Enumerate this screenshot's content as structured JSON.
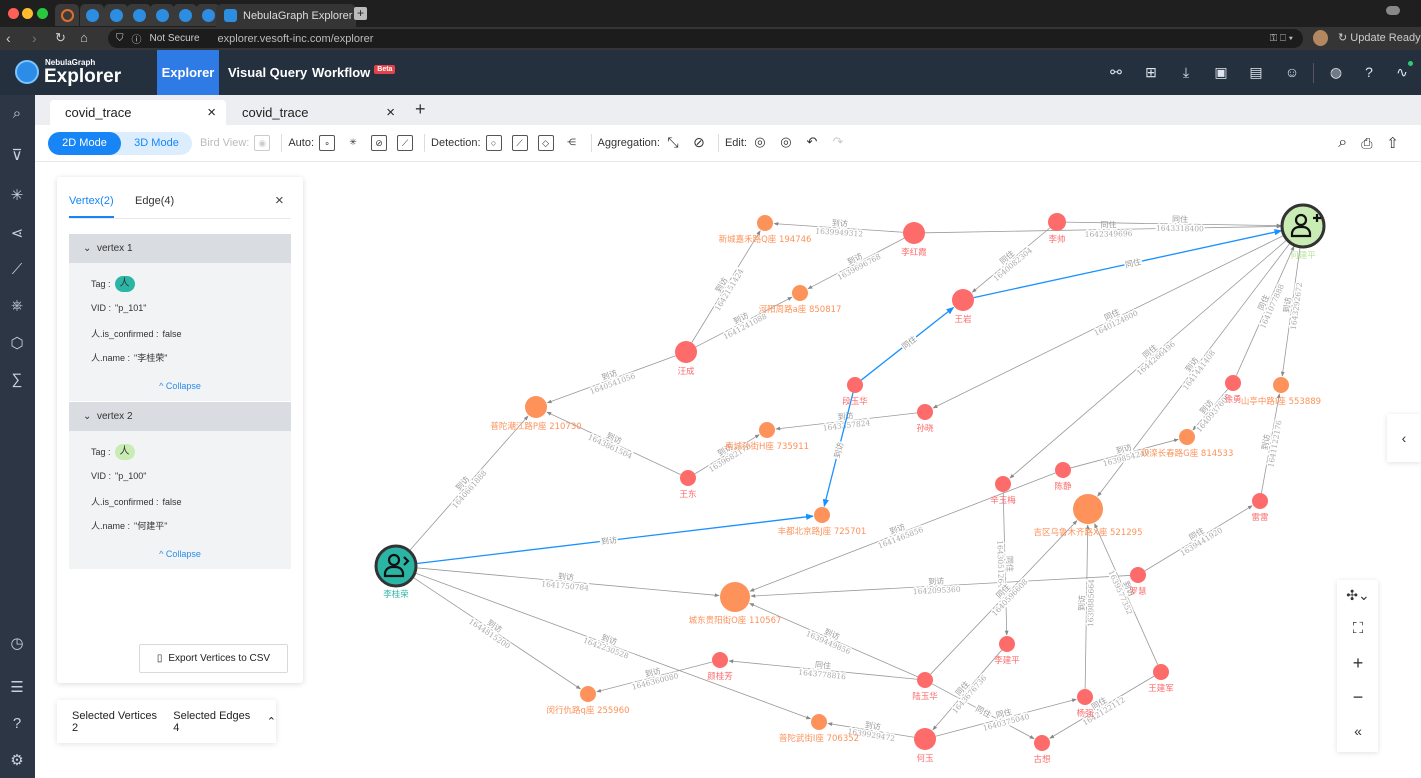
{
  "browser": {
    "tab_title": "NebulaGraph Explorer",
    "security": "Not Secure",
    "url": "explorer.vesoft-inc.com/explorer",
    "update": "Update Ready"
  },
  "app": {
    "logo_top": "NebulaGraph",
    "logo_bottom": "Explorer",
    "nav": [
      {
        "label": "Explorer"
      },
      {
        "label": "Visual Query"
      },
      {
        "label": "Workflow",
        "badge": "Beta"
      }
    ],
    "accent": "#2f7be5"
  },
  "workspace_tabs": [
    {
      "label": "covid_trace"
    },
    {
      "label": "covid_trace"
    }
  ],
  "toolbar": {
    "mode_2d": "2D Mode",
    "mode_3d": "3D Mode",
    "bird_view": "Bird View:",
    "auto": "Auto:",
    "detection": "Detection:",
    "aggregation": "Aggregation:",
    "edit": "Edit:"
  },
  "panel": {
    "tab_vertex": "Vertex(2)",
    "tab_edge": "Edge(4)",
    "collapse": "Collapse",
    "export": "Export Vertices to CSV",
    "vertices": [
      {
        "title": "vertex 1",
        "tag_label": "Tag :",
        "tag": "人",
        "tag_color": "#2bb5a5",
        "vid_label": "VID :",
        "vid": "\"p_101\"",
        "conf_label": "人.is_confirmed :",
        "conf": "false",
        "name_label": "人.name :",
        "name": "\"李桂荣\""
      },
      {
        "title": "vertex 2",
        "tag_label": "Tag :",
        "tag": "人",
        "tag_color": "#c8ecb4",
        "vid_label": "VID :",
        "vid": "\"p_100\"",
        "conf_label": "人.is_confirmed :",
        "conf": "false",
        "name_label": "人.name :",
        "name": "\"何建平\""
      }
    ]
  },
  "selection": {
    "vertices": "Selected Vertices 2",
    "edges": "Selected Edges 4"
  },
  "colors": {
    "person": "#fd6b6b",
    "place": "#fd925a",
    "selected_edge": "#1890ff",
    "edge": "#999999"
  },
  "graph": {
    "nodes": [
      {
        "id": "lgr",
        "label": "李桂荣",
        "kind": "sel1"
      },
      {
        "id": "hjp",
        "label": "何建平",
        "kind": "sel2"
      },
      {
        "id": "xcjd",
        "label": "新城嘉禾路Q座 194746",
        "kind": "place"
      },
      {
        "id": "lhx",
        "label": "李红霞",
        "kind": "person"
      },
      {
        "id": "ls",
        "label": "李帅",
        "kind": "person"
      },
      {
        "id": "hyz",
        "label": "河阳周路a座 850817",
        "kind": "place"
      },
      {
        "id": "wy",
        "label": "王岩",
        "kind": "person"
      },
      {
        "id": "wc",
        "label": "汪成",
        "kind": "person"
      },
      {
        "id": "dyh",
        "label": "段玉华",
        "kind": "person"
      },
      {
        "id": "sx",
        "label": "孙晓",
        "kind": "person"
      },
      {
        "id": "xy",
        "label": "徐勇",
        "kind": "person"
      },
      {
        "id": "stz",
        "label": "山亭中路I座 553889",
        "kind": "place"
      },
      {
        "id": "ptc",
        "label": "普陀潮江路P座 210730",
        "kind": "place"
      },
      {
        "id": "ncs",
        "label": "南城孙街H座 735911",
        "kind": "place"
      },
      {
        "id": "ssc",
        "label": "双滦长春路G座 814533",
        "kind": "place"
      },
      {
        "id": "wd",
        "label": "王东",
        "kind": "person"
      },
      {
        "id": "cj",
        "label": "陈静",
        "kind": "person"
      },
      {
        "id": "xym",
        "label": "辛玉梅",
        "kind": "person"
      },
      {
        "id": "jq",
        "label": "吉区乌鲁木齐路X座 521295",
        "kind": "place"
      },
      {
        "id": "lei",
        "label": "雷雷",
        "kind": "person"
      },
      {
        "id": "fd",
        "label": "丰都北京路J座 725701",
        "kind": "place"
      },
      {
        "id": "ldy",
        "label": "城东贵阳街O座 110567",
        "kind": "place"
      },
      {
        "id": "lh",
        "label": "罗慧",
        "kind": "person"
      },
      {
        "id": "ljp",
        "label": "李建平",
        "kind": "person"
      },
      {
        "id": "wjj",
        "label": "王建军",
        "kind": "person"
      },
      {
        "id": "ygf",
        "label": "颜桂芳",
        "kind": "person"
      },
      {
        "id": "lyh",
        "label": "陆玉华",
        "kind": "person"
      },
      {
        "id": "mhq",
        "label": "闵行仇路q座 255960",
        "kind": "place"
      },
      {
        "id": "yq",
        "label": "杨强",
        "kind": "person"
      },
      {
        "id": "pty",
        "label": "普陀武街I座 706352",
        "kind": "place"
      },
      {
        "id": "hy",
        "label": "何玉",
        "kind": "person"
      },
      {
        "id": "gx",
        "label": "古想",
        "kind": "person"
      }
    ],
    "edges": [
      {
        "s": "lhx",
        "t": "xcjd",
        "type": "到访",
        "ts": "1639949312"
      },
      {
        "s": "lhx",
        "t": "hyz",
        "type": "到访",
        "ts": "1639696768"
      },
      {
        "s": "lhx",
        "t": "hjp",
        "type": "同住",
        "ts": "1642349696"
      },
      {
        "s": "ls",
        "t": "hjp",
        "type": "同住",
        "ts": "1643318400"
      },
      {
        "s": "ls",
        "t": "wy",
        "type": "同住",
        "ts": "1640082304"
      },
      {
        "s": "wy",
        "t": "hjp",
        "type": "同住",
        "ts": "",
        "selected": true
      },
      {
        "s": "dyh",
        "t": "wy",
        "type": "同住",
        "ts": "",
        "selected": true
      },
      {
        "s": "wc",
        "t": "xcjd",
        "type": "到访",
        "ts": "1642151424"
      },
      {
        "s": "wc",
        "t": "hyz",
        "type": "到访",
        "ts": "1641241088"
      },
      {
        "s": "wc",
        "t": "ptc",
        "type": "到访",
        "ts": "1640541056"
      },
      {
        "s": "wd",
        "t": "ptc",
        "type": "到访",
        "ts": "1643861504"
      },
      {
        "s": "wd",
        "t": "ncs",
        "type": "到访",
        "ts": "1639682176"
      },
      {
        "s": "sx",
        "t": "ncs",
        "type": "到访",
        "ts": "1643357824"
      },
      {
        "s": "hjp",
        "t": "sx",
        "type": "同住",
        "ts": "1640124800"
      },
      {
        "s": "hjp",
        "t": "xym",
        "type": "同住",
        "ts": "1644266496"
      },
      {
        "s": "hjp",
        "t": "jq",
        "type": "到访",
        "ts": "1641441408"
      },
      {
        "s": "xy",
        "t": "hjp",
        "type": "同住",
        "ts": "1641077888"
      },
      {
        "s": "hjp",
        "t": "stz",
        "type": "到访",
        "ts": "1643292672"
      },
      {
        "s": "xy",
        "t": "ssc",
        "type": "到访",
        "ts": "1640937600"
      },
      {
        "s": "cj",
        "t": "ssc",
        "type": "到访",
        "ts": "1639854240"
      },
      {
        "s": "lei",
        "t": "stz",
        "type": "到访",
        "ts": "1641122176"
      },
      {
        "s": "lgr",
        "t": "ptc",
        "type": "到访",
        "ts": "1640661888"
      },
      {
        "s": "lgr",
        "t": "fd",
        "type": "到访",
        "ts": "",
        "selected": true
      },
      {
        "s": "dyh",
        "t": "fd",
        "type": "到访",
        "ts": "",
        "selected": true
      },
      {
        "s": "lgr",
        "t": "ldy",
        "type": "到访",
        "ts": "1641750784"
      },
      {
        "s": "lgr",
        "t": "mhq",
        "type": "到访",
        "ts": "1644815200"
      },
      {
        "s": "lgr",
        "t": "pty",
        "type": "到访",
        "ts": "1642230528"
      },
      {
        "s": "cj",
        "t": "ldy",
        "type": "到访",
        "ts": "1641465856"
      },
      {
        "s": "lh",
        "t": "ldy",
        "type": "到访",
        "ts": "1642095360"
      },
      {
        "s": "lh",
        "t": "lei",
        "type": "同住",
        "ts": "1639441920"
      },
      {
        "s": "xym",
        "t": "ljp",
        "type": "同住",
        "ts": "1643051264"
      },
      {
        "s": "lyh",
        "t": "jq",
        "type": "同住",
        "ts": "1640596608"
      },
      {
        "s": "lyh",
        "t": "ygf",
        "type": "同住",
        "ts": "1643778816"
      },
      {
        "s": "lyh",
        "t": "ldy",
        "type": "到访",
        "ts": "1639449856"
      },
      {
        "s": "lyh",
        "t": "gx",
        "type": "同住",
        "ts": ""
      },
      {
        "s": "ygf",
        "t": "mhq",
        "type": "到访",
        "ts": "1646360080"
      },
      {
        "s": "hy",
        "t": "pty",
        "type": "到访",
        "ts": "1639929472"
      },
      {
        "s": "ljp",
        "t": "hy",
        "type": "同住",
        "ts": "1643676736"
      },
      {
        "s": "hy",
        "t": "yq",
        "type": "同住",
        "ts": "1640375040"
      },
      {
        "s": "yq",
        "t": "jq",
        "type": "到访",
        "ts": "1639885664"
      },
      {
        "s": "wjj",
        "t": "jq",
        "type": "到访",
        "ts": "1639577352"
      },
      {
        "s": "wjj",
        "t": "gx",
        "type": "同住",
        "ts": "1642122112"
      }
    ]
  }
}
